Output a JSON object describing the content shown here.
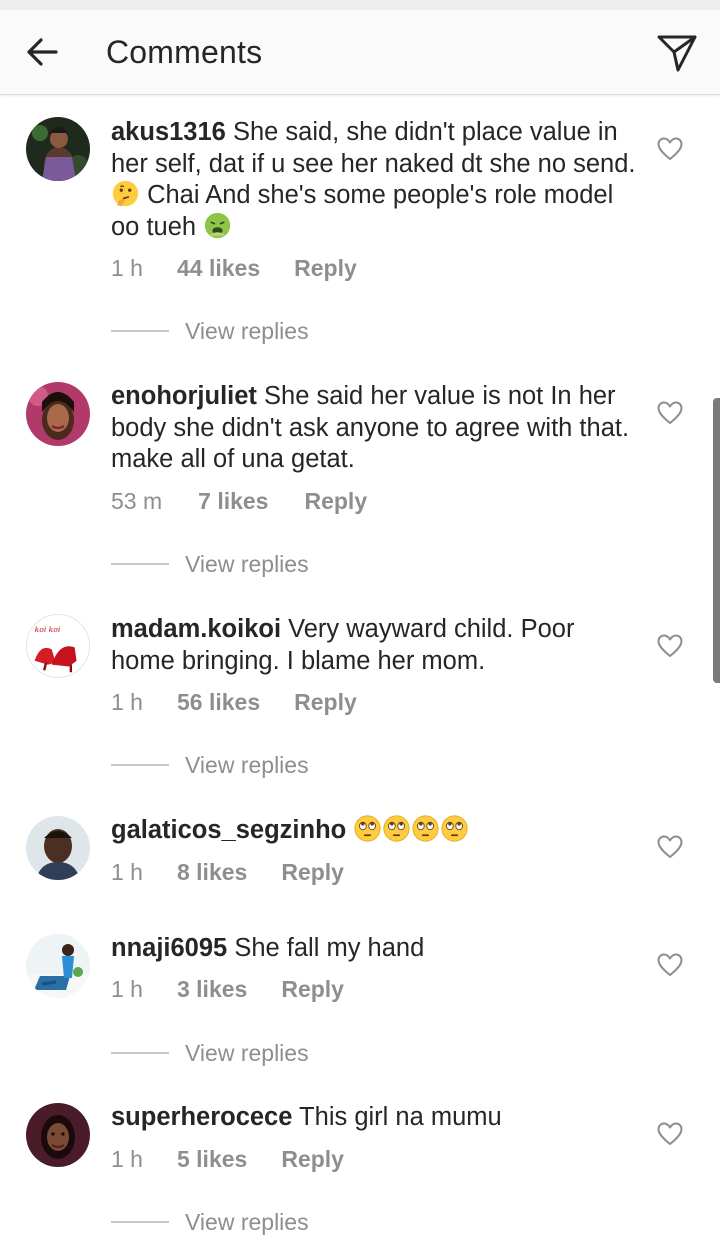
{
  "header": {
    "title": "Comments",
    "back_icon": "arrow-left-icon",
    "send_icon": "paper-plane-icon"
  },
  "colors": {
    "text": "#262626",
    "secondary": "#8e8e8e",
    "header_bg": "#fafafa"
  },
  "view_replies_label": "View replies",
  "comments": [
    {
      "username": "akus1316",
      "text_parts": [
        " She said, she didn't place value in her self, dat if u see her naked dt she no send. ",
        " Chai And she's some people's role model oo tueh "
      ],
      "emojis": [
        "thinking-face-icon",
        "nauseated-face-icon"
      ],
      "time": "1 h",
      "likes": "44 likes",
      "reply": "Reply",
      "has_view_replies": true
    },
    {
      "username": "enohorjuliet",
      "text": " She said her value is not In her body she didn't ask anyone to agree with that. make all of una getat.",
      "time": "53 m",
      "likes": "7 likes",
      "reply": "Reply",
      "has_view_replies": true
    },
    {
      "username": "madam.koikoi",
      "text": " Very wayward child. Poor home bringing. I blame her mom.",
      "time": "1 h",
      "likes": "56 likes",
      "reply": "Reply",
      "has_view_replies": true
    },
    {
      "username": "galaticos_segzinho",
      "text": " ",
      "emojis": [
        "rolling-eyes-icon",
        "rolling-eyes-icon",
        "rolling-eyes-icon",
        "rolling-eyes-icon"
      ],
      "time": "1 h",
      "likes": "8 likes",
      "reply": "Reply",
      "has_view_replies": false
    },
    {
      "username": "nnaji6095",
      "text": " She fall my hand",
      "time": "1 h",
      "likes": "3 likes",
      "reply": "Reply",
      "has_view_replies": true
    },
    {
      "username": "superherocece",
      "text": " This girl na mumu",
      "time": "1 h",
      "likes": "5 likes",
      "reply": "Reply",
      "has_view_replies": true
    }
  ]
}
